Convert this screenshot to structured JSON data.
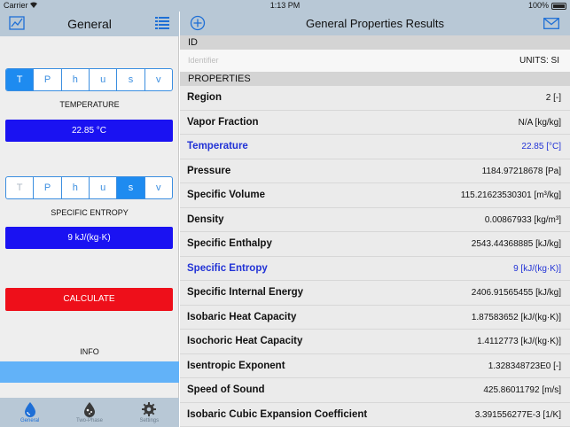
{
  "status": {
    "carrier": "Carrier",
    "time": "1:13 PM",
    "battery": "100%"
  },
  "left": {
    "title": "General",
    "selector1": {
      "options": [
        "T",
        "P",
        "h",
        "u",
        "s",
        "v"
      ],
      "selected": 0,
      "disabled": []
    },
    "label1": "TEMPERATURE",
    "value1": "22.85  °C",
    "selector2": {
      "options": [
        "T",
        "P",
        "h",
        "u",
        "s",
        "v"
      ],
      "selected": 4,
      "disabled": [
        0
      ]
    },
    "label2": "SPECIFIC ENTROPY",
    "value2": "9  kJ/(kg·K)",
    "calculate": "CALCULATE",
    "info": "INFO",
    "tabs": [
      {
        "label": "General",
        "icon": "water-drop-icon",
        "active": true
      },
      {
        "label": "Two-Phase",
        "icon": "two-phase-drop-icon",
        "active": false
      },
      {
        "label": "Settings",
        "icon": "gear-icon",
        "active": false
      }
    ]
  },
  "right": {
    "title": "General Properties Results",
    "id_header": "ID",
    "identifier_placeholder": "Identifier",
    "units": "UNITS: SI",
    "properties_header": "PROPERTIES",
    "rows": [
      {
        "name": "Region",
        "value": "2 [-]",
        "input": false
      },
      {
        "name": "Vapor Fraction",
        "value": "N/A [kg/kg]",
        "input": false
      },
      {
        "name": "Temperature",
        "value": "22.85 [°C]",
        "input": true
      },
      {
        "name": "Pressure",
        "value": "1184.97218678 [Pa]",
        "input": false
      },
      {
        "name": "Specific Volume",
        "value": "115.21623530301 [m³/kg]",
        "input": false
      },
      {
        "name": "Density",
        "value": "0.00867933 [kg/m³]",
        "input": false
      },
      {
        "name": "Specific Enthalpy",
        "value": "2543.44368885 [kJ/kg]",
        "input": false
      },
      {
        "name": "Specific Entropy",
        "value": "9 [kJ/(kg·K)]",
        "input": true
      },
      {
        "name": "Specific Internal Energy",
        "value": "2406.91565455 [kJ/kg]",
        "input": false
      },
      {
        "name": "Isobaric Heat Capacity",
        "value": "1.87583652 [kJ/(kg·K)]",
        "input": false
      },
      {
        "name": "Isochoric Heat Capacity",
        "value": "1.4112773 [kJ/(kg·K)]",
        "input": false
      },
      {
        "name": "Isentropic Exponent",
        "value": "1.328348723E0 [-]",
        "input": false
      },
      {
        "name": "Speed of Sound",
        "value": "425.86011792 [m/s]",
        "input": false
      },
      {
        "name": "Isobaric Cubic Expansion Coefficient",
        "value": "3.391556277E-3 [1/K]",
        "input": false
      }
    ]
  },
  "colors": {
    "nav_bar": "#b8c8d6",
    "accent": "#1e8bf0",
    "value_box": "#1a12f2",
    "calculate": "#ee0f1a",
    "input_text": "#2233d6",
    "info_bar": "#62b2f8"
  }
}
